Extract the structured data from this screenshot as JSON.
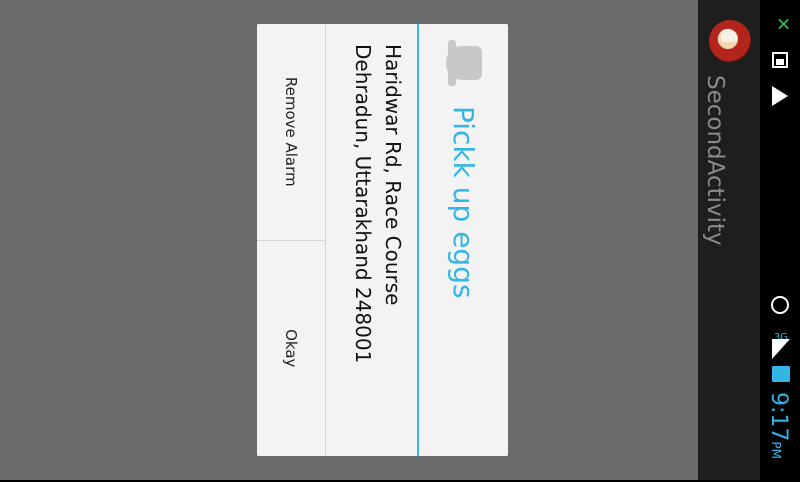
{
  "app": {
    "title": "SecondActivity",
    "icon": "app-icon"
  },
  "status": {
    "time": "9:17",
    "ampm": "PM",
    "network": "3G",
    "accent": "#33b5e5"
  },
  "dialog": {
    "icon": "bell-icon",
    "title": "Pickk up eggs",
    "message_lines": [
      "Haridwar Rd, Race Course",
      "Dehradun, Uttarakhand 248001"
    ],
    "buttons": {
      "remove": "Remove Alarm",
      "okay": "Okay"
    }
  }
}
